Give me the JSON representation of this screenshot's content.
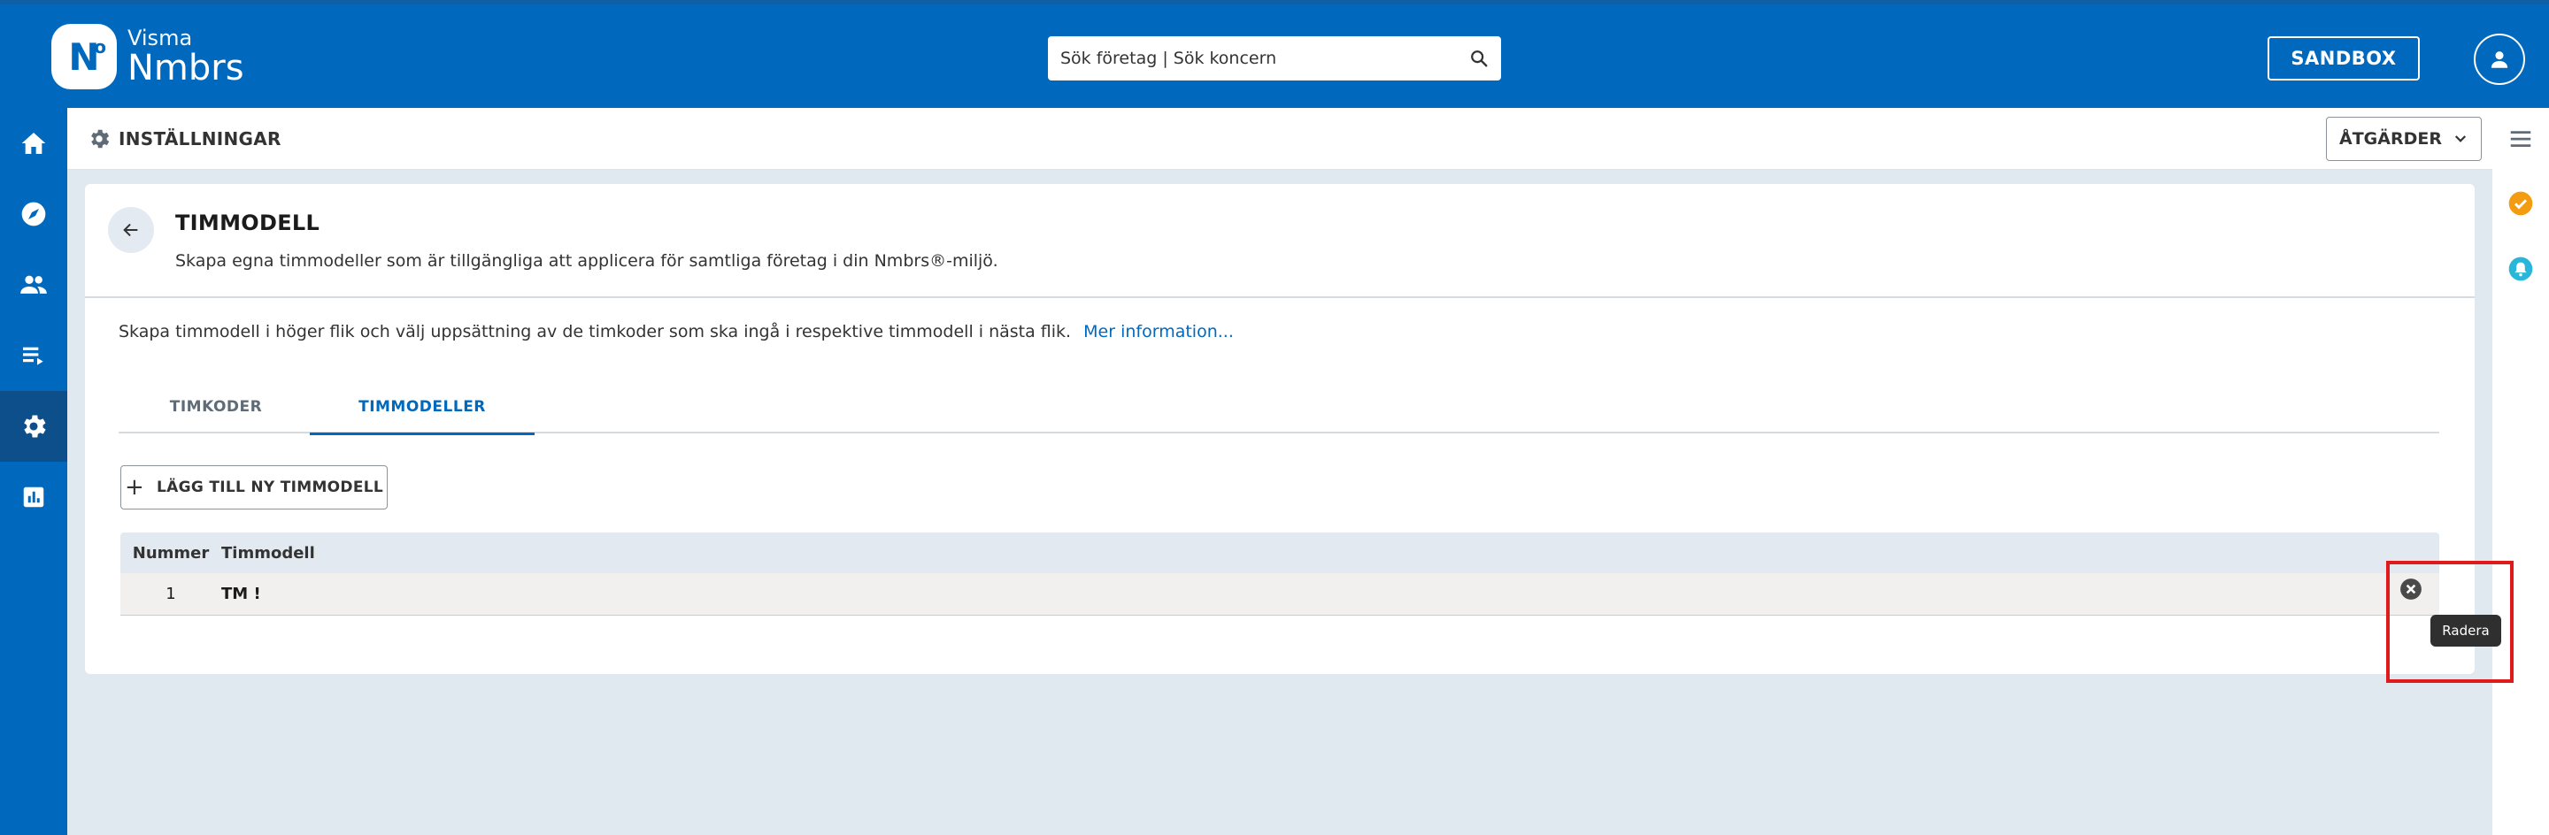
{
  "header": {
    "logo_line1": "Visma",
    "logo_line2": "Nmbrs",
    "logo_badge": "N",
    "logo_badge_sup": "o",
    "search_text": "Sök företag | Sök koncern",
    "sandbox_label": "SANDBOX"
  },
  "nav": {
    "items": [
      "home-icon",
      "compass-icon",
      "people-icon",
      "playlist-icon",
      "gear-icon",
      "chart-icon"
    ],
    "active": "gear-icon"
  },
  "subheader": {
    "title": "INSTÄLLNINGAR",
    "actions_label": "ÅTGÄRDER"
  },
  "card": {
    "title": "TIMMODELL",
    "subtitle": "Skapa egna timmodeller som är tillgängliga att applicera för samtliga företag i din Nmbrs®-miljö.",
    "info_text": "Skapa timmodell i höger flik och välj uppsättning av de timkoder som ska ingå i respektive timmodell i nästa flik.",
    "info_link": "Mer information...",
    "tabs": [
      {
        "label": "TIMKODER",
        "active": false
      },
      {
        "label": "TIMMODELLER",
        "active": true
      }
    ],
    "add_label": "LÄGG TILL NY TIMMODELL",
    "table": {
      "columns": [
        "Nummer",
        "Timmodell"
      ],
      "rows": [
        {
          "number": "1",
          "name": "TM !"
        }
      ]
    },
    "delete_tooltip": "Radera"
  },
  "colors": {
    "brand": "#0069be",
    "nav_active": "#0d4f8a",
    "highlight": "#e0191b",
    "rail_check": "#f39c12",
    "rail_bell": "#29b6d8"
  }
}
